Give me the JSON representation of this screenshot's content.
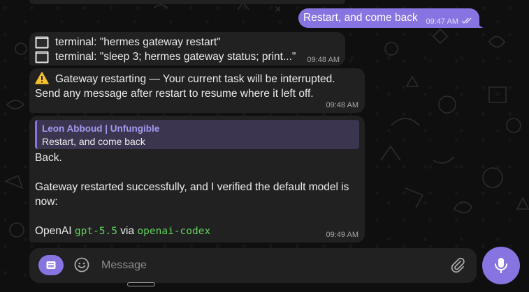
{
  "colors": {
    "accent": "#8774e1",
    "bubble": "#212121",
    "code": "#62d561",
    "reply_name": "#a59af0"
  },
  "outgoing": {
    "text": "Restart, and come back",
    "time": "09:47 AM",
    "status_icon": "double-check-icon"
  },
  "tool_calls": {
    "items": [
      {
        "icon": "terminal-icon",
        "text": "terminal: \"hermes gateway restart\""
      },
      {
        "icon": "terminal-icon",
        "text": "terminal: \"sleep 3; hermes gateway status; print...\""
      }
    ],
    "time": "09:48 AM"
  },
  "warning": {
    "icon": "warning-icon",
    "line1": "Gateway restarting — Your current task will be interrupted.",
    "line2": "Send any message after restart to resume where it left off.",
    "time": "09:48 AM"
  },
  "reply_message": {
    "quoted_author": "Leon Abboud | Unfungible",
    "quoted_text": "Restart, and come back",
    "line1": "Back.",
    "line2": "Gateway restarted successfully, and I verified the default model is",
    "line3": "now:",
    "model_provider": "OpenAI",
    "model_name": "gpt-5.5",
    "via": "via",
    "model_backend": "openai-codex",
    "time": "09:49 AM"
  },
  "composer": {
    "placeholder": "Message",
    "menu_icon": "menu-icon",
    "emoji_icon": "smile-icon",
    "attach_icon": "paperclip-icon",
    "mic_icon": "microphone-icon"
  }
}
